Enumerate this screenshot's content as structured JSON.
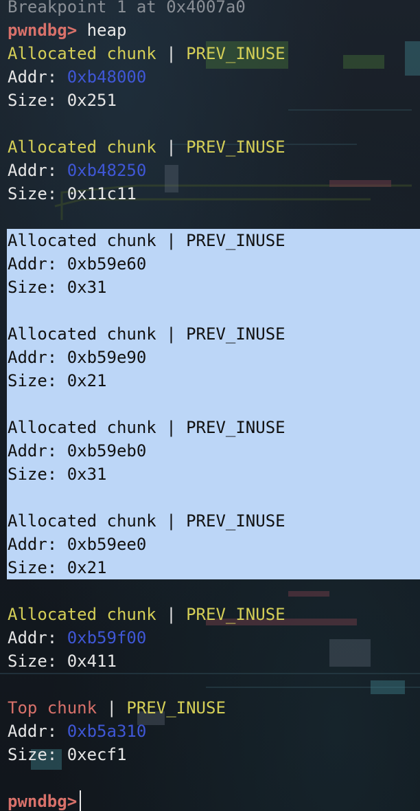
{
  "header_line": "Breakpoint 1 at 0x4007a0",
  "prompt": "pwndbg>",
  "command": "heap",
  "separator": "|",
  "flag": "PREV_INUSE",
  "addr_label": "Addr:",
  "size_label": "Size:",
  "chunks": [
    {
      "type": "Allocated chunk",
      "addr": "0xb48000",
      "size": "0x251"
    },
    {
      "type": "Allocated chunk",
      "addr": "0xb48250",
      "size": "0x11c11"
    },
    {
      "type": "Allocated chunk",
      "addr": "0xb59e60",
      "size": "0x31"
    },
    {
      "type": "Allocated chunk",
      "addr": "0xb59e90",
      "size": "0x21"
    },
    {
      "type": "Allocated chunk",
      "addr": "0xb59eb0",
      "size": "0x31"
    },
    {
      "type": "Allocated chunk",
      "addr": "0xb59ee0",
      "size": "0x21"
    },
    {
      "type": "Allocated chunk",
      "addr": "0xb59f00",
      "size": "0x411"
    },
    {
      "type": "Top chunk",
      "addr": "0xb5a310",
      "size": "0xecf1"
    }
  ],
  "colors": {
    "prompt": "#d8716a",
    "chunk_label": "#d5cf57",
    "top_chunk_label": "#d8716a",
    "address": "#3f57d6",
    "selection": "#bcd6f7",
    "background": "#151a21"
  }
}
